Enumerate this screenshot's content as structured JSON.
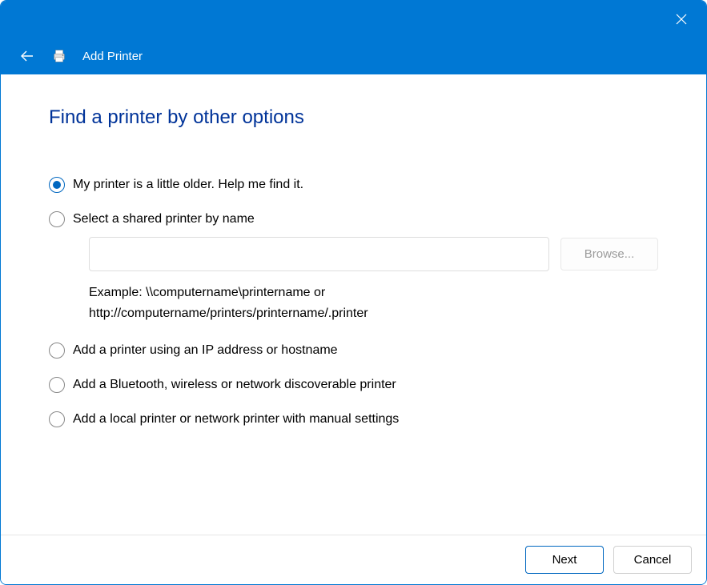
{
  "header": {
    "title": "Add Printer"
  },
  "page": {
    "title": "Find a printer by other options"
  },
  "options": {
    "older": "My printer is a little older. Help me find it.",
    "shared": "Select a shared printer by name",
    "ip": "Add a printer using an IP address or hostname",
    "bluetooth": "Add a Bluetooth, wireless or network discoverable printer",
    "local": "Add a local printer or network printer with manual settings"
  },
  "shared_section": {
    "input_value": "",
    "browse_label": "Browse...",
    "example_text": "Example: \\\\computername\\printername or http://computername/printers/printername/.printer"
  },
  "footer": {
    "next_label": "Next",
    "cancel_label": "Cancel"
  }
}
